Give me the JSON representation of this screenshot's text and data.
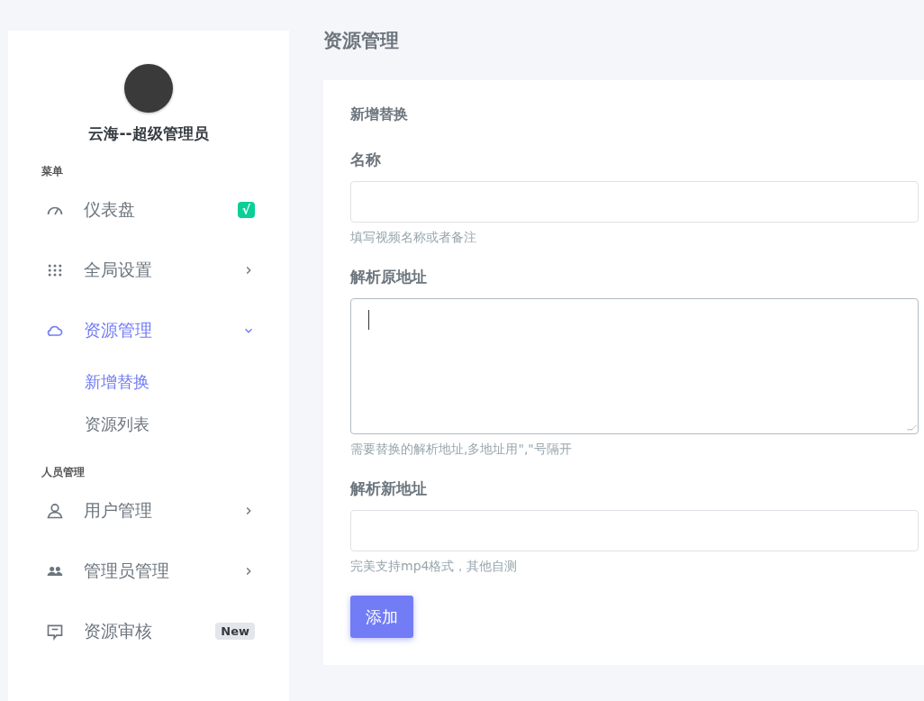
{
  "sidebar": {
    "user": {
      "name": "云海--超级管理员"
    },
    "sections": [
      {
        "title": "菜单",
        "items": [
          {
            "label": "仪表盘",
            "kind": "badge",
            "badge": "√",
            "color": "#0acf97",
            "selected": false
          },
          {
            "label": "全局设置",
            "kind": "submenu",
            "expanded": false,
            "selected": false
          },
          {
            "label": "资源管理",
            "kind": "submenu",
            "expanded": true,
            "selected": true,
            "children": [
              {
                "label": "新增替换",
                "selected": true
              },
              {
                "label": "资源列表",
                "selected": false
              }
            ]
          }
        ]
      },
      {
        "title": "人员管理",
        "items": [
          {
            "label": "用户管理",
            "kind": "submenu",
            "expanded": false,
            "selected": false
          },
          {
            "label": "管理员管理",
            "kind": "submenu",
            "expanded": false,
            "selected": false
          },
          {
            "label": "资源审核",
            "kind": "tag",
            "badge": "New",
            "selected": false
          }
        ]
      }
    ]
  },
  "page_title": "资源管理",
  "form": {
    "title": "新增替换",
    "fields": [
      {
        "label": "名称",
        "kind": "input",
        "help": "填写视频名称或者备注",
        "focused": false
      },
      {
        "label": "解析原地址",
        "kind": "textarea",
        "help": "需要替换的解析地址,多地址用\",\"号隔开",
        "focused": true
      },
      {
        "label": "解析新地址",
        "kind": "input",
        "help": "完美支持mp4格式，其他自测",
        "focused": false
      }
    ],
    "submit": "添加"
  }
}
